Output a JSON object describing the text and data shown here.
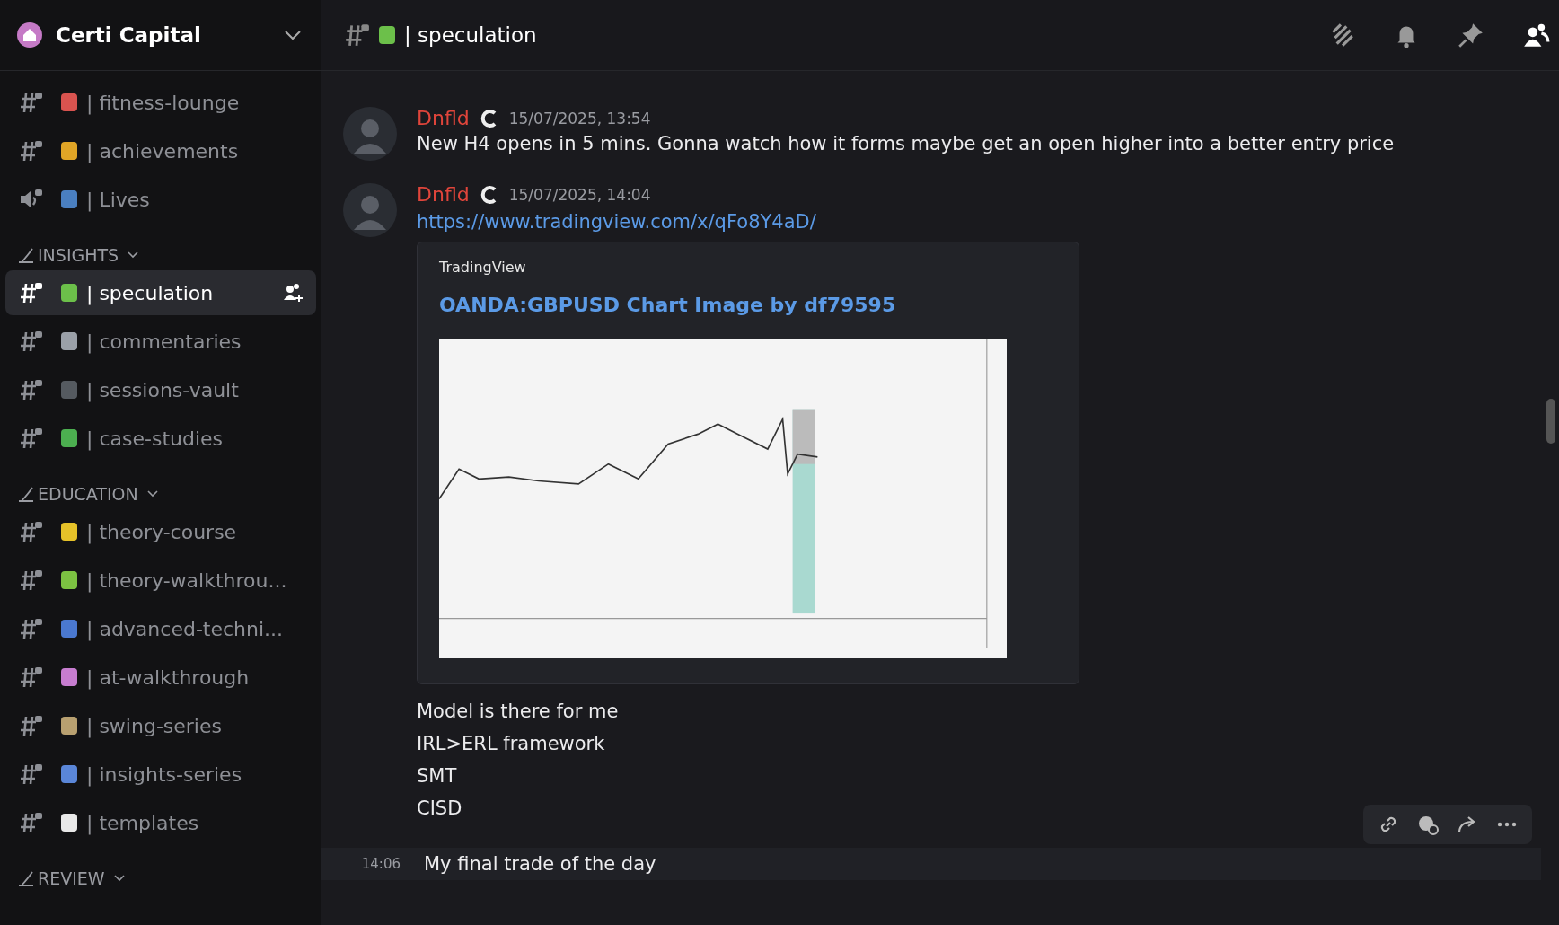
{
  "server": {
    "name": "Certi Capital"
  },
  "sidebar": {
    "groups": [
      {
        "channels": [
          {
            "kind": "text",
            "name": "| fitness-lounge",
            "color": "#d9534f",
            "selected": false
          },
          {
            "kind": "text",
            "name": "| achievements",
            "color": "#e0a526",
            "selected": false
          },
          {
            "kind": "voice",
            "name": "| Lives",
            "color": "#4a7fc0",
            "selected": false
          }
        ]
      },
      {
        "category": "INSIGHTS",
        "channels": [
          {
            "kind": "text",
            "name": "| speculation",
            "color": "#6cc04a",
            "selected": true
          },
          {
            "kind": "text",
            "name": "| commentaries",
            "color": "#9aa0a8",
            "selected": false
          },
          {
            "kind": "text",
            "name": "| sessions-vault",
            "color": "#555a60",
            "selected": false
          },
          {
            "kind": "text",
            "name": "| case-studies",
            "color": "#4caf50",
            "selected": false
          }
        ]
      },
      {
        "category": "EDUCATION",
        "channels": [
          {
            "kind": "text",
            "name": "| theory-course",
            "color": "#e6c229",
            "selected": false
          },
          {
            "kind": "text",
            "name": "| theory-walkthrou...",
            "color": "#7cc242",
            "selected": false
          },
          {
            "kind": "text",
            "name": "| advanced-techni...",
            "color": "#4a78d0",
            "selected": false
          },
          {
            "kind": "text",
            "name": "| at-walkthrough",
            "color": "#c77dd0",
            "selected": false
          },
          {
            "kind": "text",
            "name": "| swing-series",
            "color": "#b8a070",
            "selected": false
          },
          {
            "kind": "text",
            "name": "| insights-series",
            "color": "#5a86d8",
            "selected": false
          },
          {
            "kind": "text",
            "name": "| templates",
            "color": "#e8e8e8",
            "selected": false
          }
        ]
      },
      {
        "category": "REVIEW"
      }
    ]
  },
  "channel_header": {
    "name": "| speculation"
  },
  "messages": [
    {
      "kind": "post",
      "author": "Dnfld",
      "time": "15/07/2025, 13:54",
      "lines": [
        "New H4 opens in 5 mins. Gonna watch how it forms  maybe get an open higher into a better entry price"
      ]
    },
    {
      "kind": "post",
      "author": "Dnfld",
      "time": "15/07/2025, 14:04",
      "link": "https://www.tradingview.com/x/qFo8Y4aD/",
      "embed": {
        "provider": "TradingView",
        "title": "OANDA:GBPUSD Chart Image by df79595"
      },
      "lines": [
        "Model is there for me",
        "IRL>ERL framework",
        "SMT",
        "CISD"
      ]
    },
    {
      "kind": "followup",
      "time": "14:06",
      "lines": [
        "My final trade of the day"
      ]
    }
  ]
}
